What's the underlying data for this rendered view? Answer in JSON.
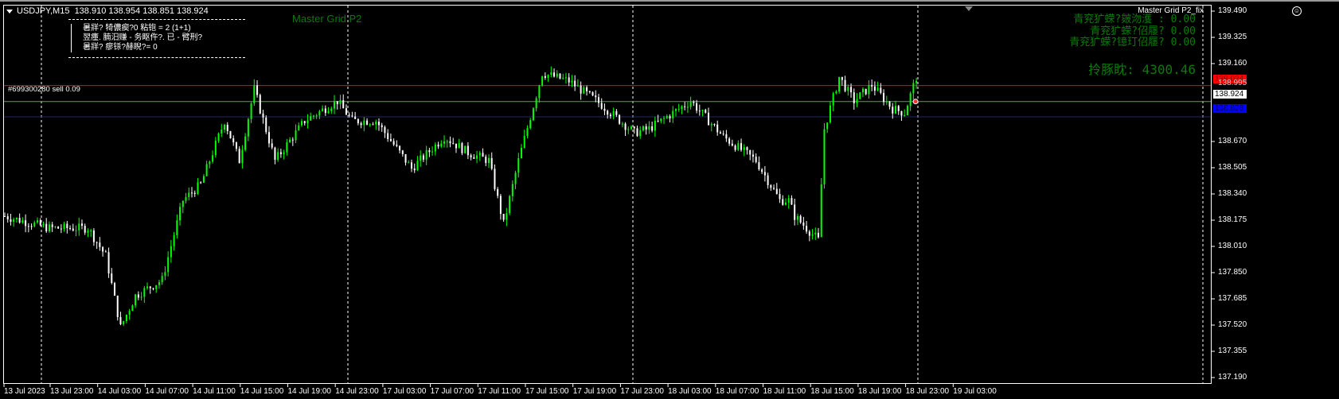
{
  "header": {
    "symbol": "USDJPY,M15",
    "ohlc": "138.910 138.954 138.851 138.924"
  },
  "info_panel": {
    "lines": [
      "暑牂? 犄儂瘈?0 粘铇 = 2 (1+1)",
      "翌瘇. 腩汨赚 - 务眍仵?. 已 - 臂刑?",
      "暑牂? 瘳铩?赫睨?= 0"
    ]
  },
  "ea_label": "Master Grid P2",
  "ea_name": "Master Grid P2_fix",
  "stats": {
    "lines": [
      "青兖犷蝾?皴沕濩  : 0.00",
      "青兖犷蝾?佋屦? 0.00",
      "青兖犷蝾?镱玎佋屦? 0.00"
    ],
    "equity": "拎豚眈: 4300.46"
  },
  "order_label": "#699300280 sell 0.09",
  "price_lines": {
    "red": {
      "price": "139.024",
      "color": "#ff0000"
    },
    "bid": {
      "price": "138.924",
      "color": "#3cb43c"
    },
    "blue": {
      "price": "138.828",
      "color": "#0000ff"
    }
  },
  "price_axis": [
    "139.490",
    "139.325",
    "139.160",
    "138.995",
    "138.670",
    "138.505",
    "138.340",
    "138.175",
    "138.010",
    "137.850",
    "137.685",
    "137.520",
    "137.355",
    "137.190"
  ],
  "time_axis": [
    "13 Jul 2023",
    "13 Jul 23:00",
    "14 Jul 03:00",
    "14 Jul 07:00",
    "14 Jul 11:00",
    "14 Jul 15:00",
    "14 Jul 19:00",
    "14 Jul 23:00",
    "17 Jul 03:00",
    "17 Jul 07:00",
    "17 Jul 11:00",
    "17 Jul 15:00",
    "17 Jul 19:00",
    "17 Jul 23:00",
    "18 Jul 03:00",
    "18 Jul 07:00",
    "18 Jul 11:00",
    "18 Jul 15:00",
    "18 Jul 19:00",
    "18 Jul 23:00",
    "19 Jul 03:00"
  ],
  "chart_data": {
    "type": "candlestick",
    "symbol": "USDJPY",
    "timeframe": "M15",
    "ylim": [
      137.19,
      139.49
    ],
    "bull_color": "#00ff00",
    "bear_color": "#ffffff",
    "path_bar_index": [
      0,
      15,
      28,
      34,
      39,
      44,
      53,
      60,
      66,
      74,
      79,
      84,
      91,
      101,
      112,
      117,
      125,
      137,
      148,
      156,
      163,
      168,
      173,
      181,
      190,
      201,
      212,
      217,
      231,
      242,
      253,
      261,
      264,
      266,
      274,
      276,
      281,
      286,
      292,
      299,
      303,
      307
    ],
    "path_close": [
      138.206,
      138.131,
      138.131,
      137.957,
      137.509,
      137.708,
      137.807,
      138.305,
      138.405,
      138.803,
      138.554,
      139.002,
      138.554,
      138.803,
      138.927,
      138.803,
      138.803,
      138.504,
      138.703,
      138.604,
      138.554,
      138.156,
      138.554,
      139.102,
      139.052,
      138.903,
      138.728,
      138.753,
      138.927,
      138.703,
      138.554,
      138.305,
      138.305,
      138.206,
      138.056,
      138.753,
      139.077,
      138.927,
      139.027,
      138.878,
      138.853,
      139.077
    ]
  }
}
